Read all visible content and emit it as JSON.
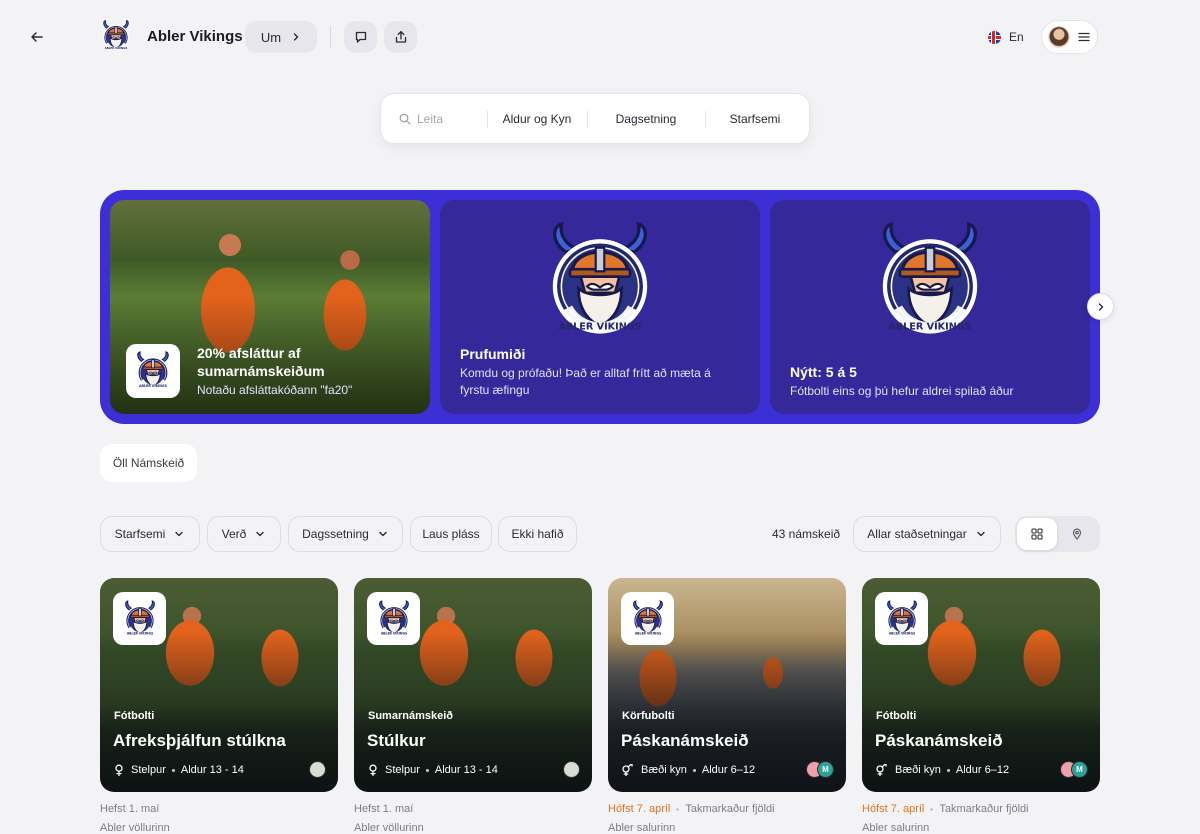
{
  "header": {
    "club_name": "Abler Vikings",
    "about_label": "Um",
    "language": "En"
  },
  "search": {
    "placeholder": "Leita",
    "age_gender": "Aldur og Kyn",
    "date": "Dagsetning",
    "activity": "Starfsemi"
  },
  "promos": [
    {
      "title": "20% afsláttur af sumarnámskeiðum",
      "subtitle": "Notaðu afsláttakóðann \"fa20\""
    },
    {
      "title": "Prufumiði",
      "subtitle": "Komdu og prófaðu! Það er alltaf frítt að mæta á fyrstu æfingu"
    },
    {
      "title": "Nýtt: 5 á 5",
      "subtitle": "Fótbolti eins og þú hefur aldrei spilað áður"
    }
  ],
  "tabs": {
    "all_courses": "Öll Námskeið"
  },
  "filters": {
    "activity": "Starfsemi",
    "price": "Verð",
    "date": "Dagssetning",
    "available": "Laus pláss",
    "not_started": "Ekki hafið",
    "count": "43 námskeið",
    "locations": "Allar staðsetningar"
  },
  "courses": [
    {
      "category": "Fótbolti",
      "title": "Afreksþjálfun stúlkna",
      "gender": "Stelpur",
      "age": "Aldur 13 - 14",
      "start": "Hefst 1. maí",
      "capacity": "",
      "location": "Abler völlurinn"
    },
    {
      "category": "Sumarnámskeið",
      "title": "Stúlkur",
      "gender": "Stelpur",
      "age": "Aldur 13 - 14",
      "start": "Hefst 1. maí",
      "capacity": "",
      "location": "Abler völlurinn"
    },
    {
      "category": "Körfubolti",
      "title": "Páskanámskeið",
      "gender": "Bæði kyn",
      "age": "Aldur 6–12",
      "start": "Hófst 7. apríl",
      "capacity": "Takmarkaður fjöldi",
      "location": "Abler salurinn"
    },
    {
      "category": "Fótbolti",
      "title": "Páskanámskeið",
      "gender": "Bæði kyn",
      "age": "Aldur 6–12",
      "start": "Hófst 7. apríl",
      "capacity": "Takmarkaður fjöldi",
      "location": "Abler salurinn"
    }
  ],
  "avatar_initial": "M",
  "colors": {
    "promo_bg": "#3c2fd6",
    "promo_card": "#34289a",
    "accent_orange": "#e0731b",
    "page_bg": "#f3f3f6"
  },
  "icons": [
    "back-arrow-icon",
    "chevron-right-icon",
    "chat-icon",
    "share-icon",
    "flag-icon",
    "menu-icon",
    "search-icon",
    "chevron-down-icon",
    "grid-icon",
    "map-pin-icon",
    "female-icon",
    "gender-both-icon"
  ]
}
